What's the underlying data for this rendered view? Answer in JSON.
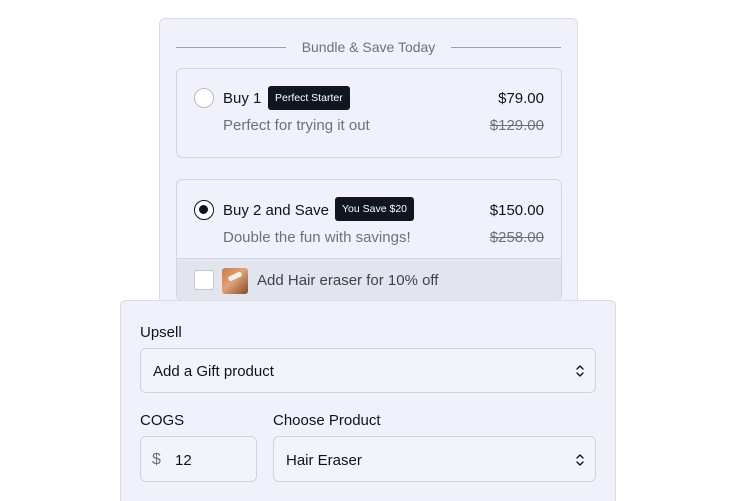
{
  "bundle": {
    "title": "Bundle & Save Today",
    "options": [
      {
        "title": "Buy 1",
        "badge": "Perfect Starter",
        "subtitle": "Perfect for trying it out",
        "price": "$79.00",
        "compare_price": "$129.00",
        "selected": false
      },
      {
        "title": "Buy 2 and Save",
        "badge": "You Save $20",
        "subtitle": "Double the fun with savings!",
        "price": "$150.00",
        "compare_price": "$258.00",
        "selected": true,
        "addon": {
          "label": "Add Hair eraser for 10% off",
          "checked": false
        }
      }
    ]
  },
  "settings": {
    "upsell": {
      "label": "Upsell",
      "value": "Add a Gift product"
    },
    "cogs": {
      "label": "COGS",
      "prefix": "$",
      "value": "12"
    },
    "product": {
      "label": "Choose Product",
      "value": "Hair Eraser"
    }
  },
  "colors": {
    "panel_bg": "#f0f1fb",
    "badge_bg": "#0f1621",
    "text_primary": "#0b1220",
    "text_muted": "#6b7180"
  }
}
